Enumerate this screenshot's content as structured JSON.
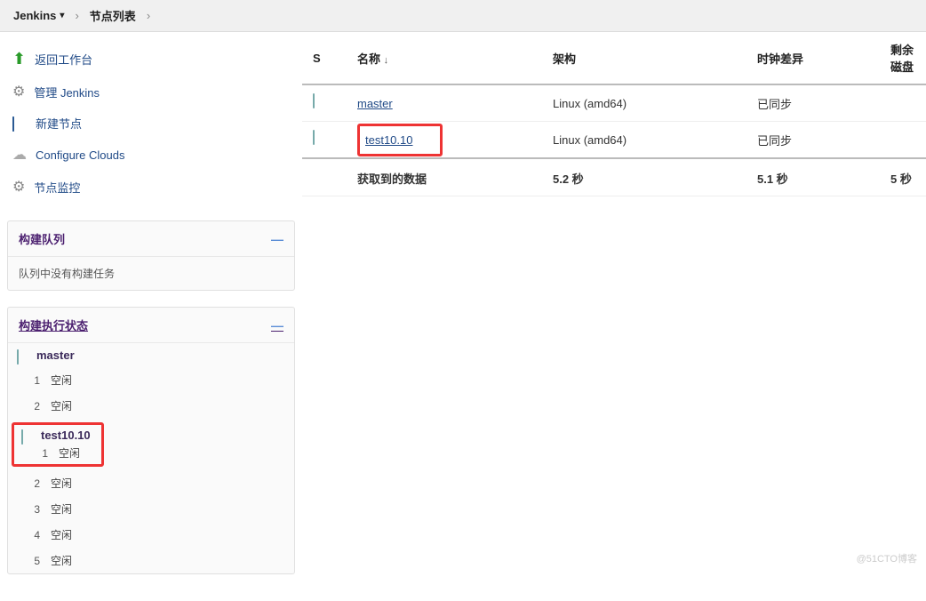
{
  "breadcrumb": {
    "root": "Jenkins",
    "current": "节点列表"
  },
  "sidebar": {
    "nav": [
      {
        "label": "返回工作台",
        "icon": "up-arrow"
      },
      {
        "label": "管理 Jenkins",
        "icon": "gear"
      },
      {
        "label": "新建节点",
        "icon": "monitor"
      },
      {
        "label": "Configure Clouds",
        "icon": "cloud"
      },
      {
        "label": "节点监控",
        "icon": "gear"
      }
    ],
    "buildQueue": {
      "title": "构建队列",
      "empty": "队列中没有构建任务"
    },
    "executors": {
      "title": "构建执行状态",
      "nodes": [
        {
          "name": "master",
          "slots": [
            {
              "n": "1",
              "status": "空闲"
            },
            {
              "n": "2",
              "status": "空闲"
            }
          ]
        },
        {
          "name": "test10.10",
          "highlighted": true,
          "slots": [
            {
              "n": "1",
              "status": "空闲"
            },
            {
              "n": "2",
              "status": "空闲"
            },
            {
              "n": "3",
              "status": "空闲"
            },
            {
              "n": "4",
              "status": "空闲"
            },
            {
              "n": "5",
              "status": "空闲"
            }
          ]
        }
      ]
    }
  },
  "table": {
    "headers": {
      "s": "S",
      "name": "名称",
      "arch": "架构",
      "clock": "时钟差异",
      "disk": "剩余磁盘"
    },
    "rows": [
      {
        "name": "master",
        "arch": "Linux (amd64)",
        "clock": "已同步",
        "highlighted": false
      },
      {
        "name": "test10.10",
        "arch": "Linux (amd64)",
        "clock": "已同步",
        "highlighted": true
      }
    ],
    "footer": {
      "label": "获取到的数据",
      "col1": "5.2 秒",
      "col2": "5.1 秒",
      "col3": "5 秒"
    }
  },
  "watermark": "@51CTO博客"
}
